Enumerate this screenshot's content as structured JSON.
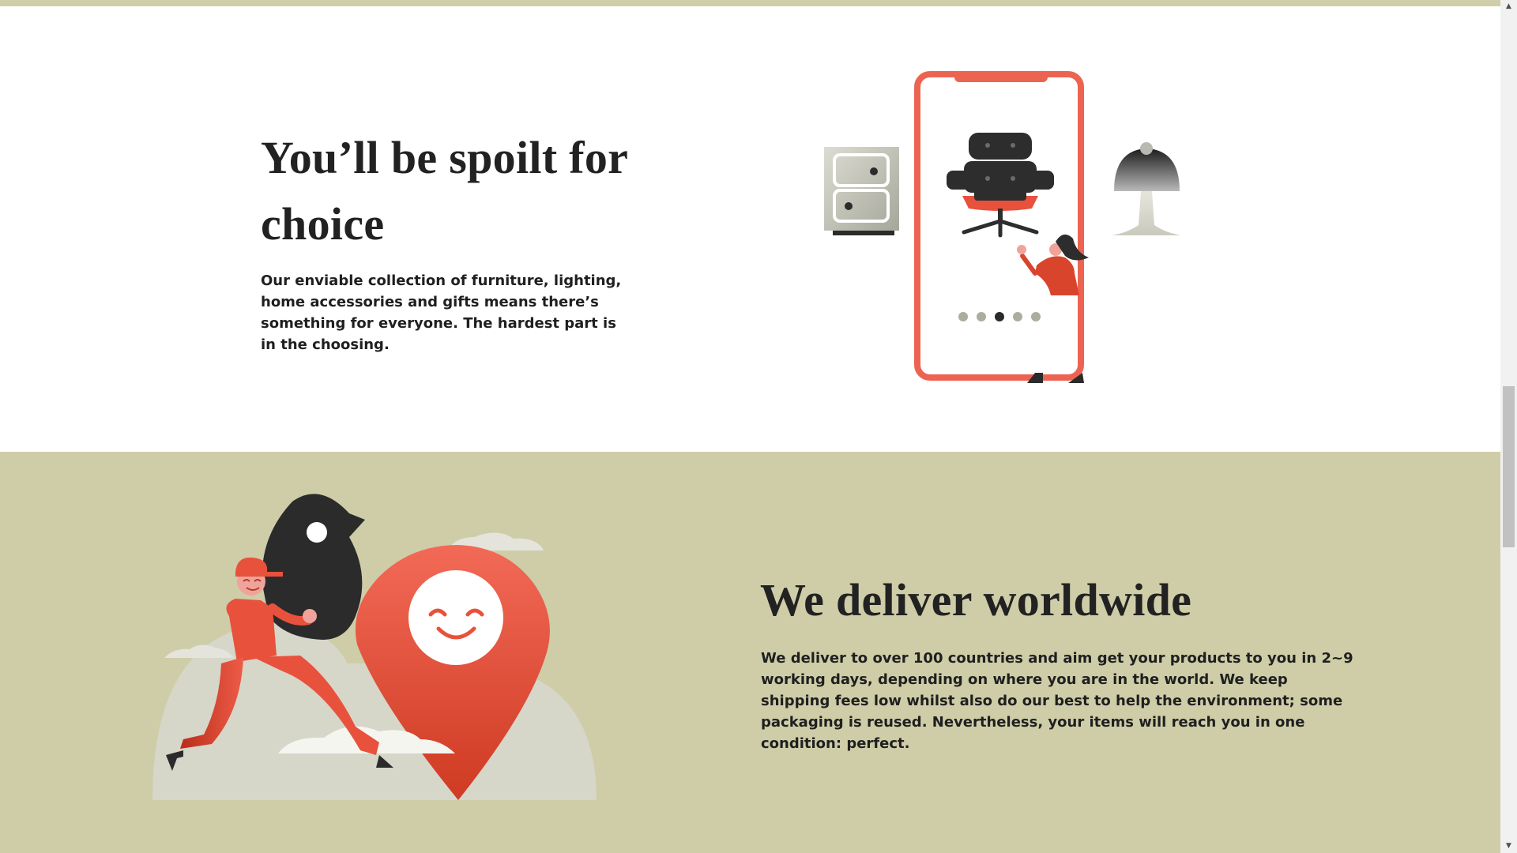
{
  "choice_section": {
    "title": "You’ll be spoilt for choice",
    "text": "Our enviable collection of furniture, lighting, home accessories and gifts means there’s something for everyone. The hardest part is in the choosing.",
    "illustration_icons": [
      "phone-frame-icon",
      "armchair-icon",
      "drawer-cabinet-icon",
      "table-lamp-icon",
      "person-icon"
    ],
    "carousel_active_dot": 3,
    "carousel_dot_count": 5
  },
  "delivery_section": {
    "title": "We deliver worldwide",
    "text": "We deliver to over 100 countries and aim get your products to you in 2~9 working days, depending on where you are in the world. We keep shipping fees low whilst also do our best to help the environment; some packaging is reused. Nevertheless, your items will reach you in one condition: perfect.",
    "illustration_icons": [
      "location-pin-icon",
      "smiley-face-icon",
      "courier-icon",
      "bird-icon",
      "cloud-icon"
    ]
  },
  "colors": {
    "olive_background": "#cecda8",
    "accent_red": "#e8513c",
    "heading_text": "#222222",
    "body_text": "#1f1f1f"
  },
  "scrollbar": {
    "up_icon": "▲",
    "down_icon": "▼"
  }
}
